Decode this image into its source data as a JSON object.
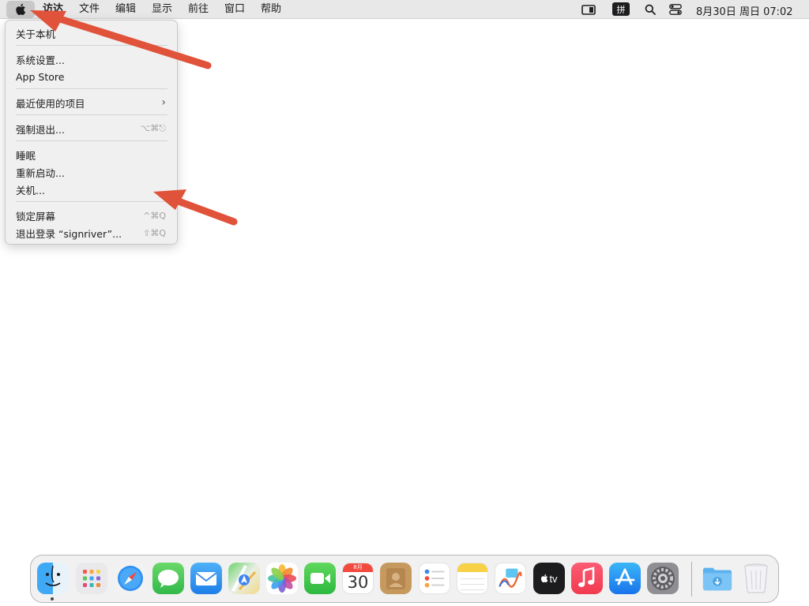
{
  "menubar": {
    "app_name": "访达",
    "menus": [
      "文件",
      "编辑",
      "显示",
      "前往",
      "窗口",
      "帮助"
    ],
    "ime": "拼",
    "clock": "8月30日 周日  07:02",
    "icons": [
      "apple-icon",
      "screen-mirroring-icon",
      "input-method-icon",
      "search-icon",
      "control-center-icon"
    ]
  },
  "apple_menu": {
    "items": {
      "about": "关于本机",
      "settings": "系统设置...",
      "appstore": "App Store",
      "recent": "最近使用的项目",
      "force_quit": "强制退出...",
      "force_quit_shortcut": "⌥⌘⎋",
      "sleep": "睡眠",
      "restart": "重新启动...",
      "shutdown": "关机...",
      "lock": "锁定屏幕",
      "lock_shortcut": "^⌘Q",
      "logout": "退出登录 “signriver”...",
      "logout_shortcut": "⇧⌘Q"
    }
  },
  "annotations": {
    "arrow_color": "#e0523a"
  },
  "dock": {
    "apps": [
      "finder-icon",
      "launchpad-icon",
      "safari-icon",
      "messages-icon",
      "mail-icon",
      "maps-icon",
      "photos-icon",
      "facetime-icon",
      "calendar-icon",
      "contacts-icon",
      "reminders-icon",
      "notes-icon",
      "freeform-icon",
      "apple-tv-icon",
      "music-icon",
      "app-store-icon",
      "system-settings-icon"
    ],
    "calendar_month": "8月",
    "calendar_day": "30",
    "tv_label": "tv",
    "downloads": "downloads-folder-icon",
    "trash": "trash-icon"
  }
}
